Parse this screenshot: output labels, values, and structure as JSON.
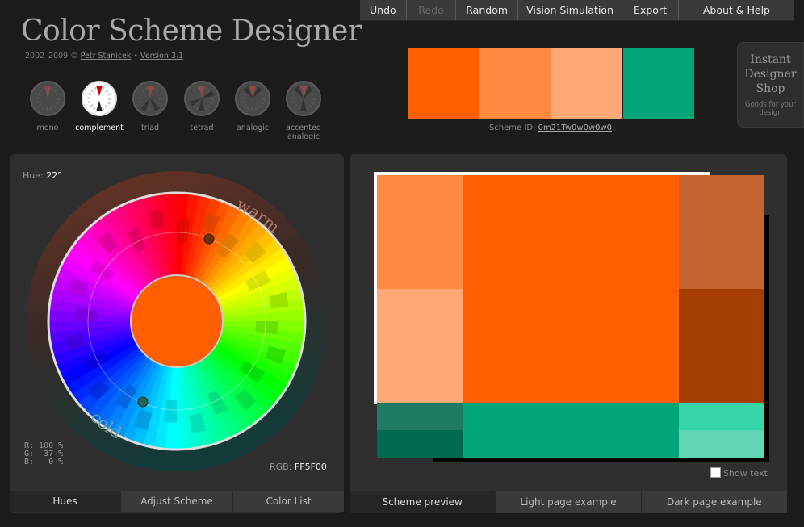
{
  "menu": [
    {
      "label": "Undo",
      "enabled": true
    },
    {
      "label": "Redo",
      "enabled": false
    },
    {
      "label": "Random",
      "enabled": true
    },
    {
      "label": "Vision Simulation",
      "enabled": true
    },
    {
      "label": "Export",
      "enabled": true
    },
    {
      "label": "About & Help",
      "enabled": true
    }
  ],
  "header": {
    "title": "Color Scheme Designer",
    "copyright_prefix": "2002–2009 © ",
    "author": "Petr Stanicek",
    "separator": " • ",
    "version": "Version 3.1"
  },
  "scheme_types": [
    {
      "label": "mono",
      "active": false
    },
    {
      "label": "complement",
      "active": true
    },
    {
      "label": "triad",
      "active": false
    },
    {
      "label": "tetrad",
      "active": false
    },
    {
      "label": "analogic",
      "active": false
    },
    {
      "label": "accented analogic",
      "active": false
    }
  ],
  "swatch_colors": [
    "#FF5F00",
    "#FF8A3F",
    "#FFAA76",
    "#00A578"
  ],
  "scheme_id": {
    "label": "Scheme ID: ",
    "value": "0m21Tw0w0w0w0"
  },
  "shop": {
    "title": "Instant Designer Shop",
    "subtitle": "Goods for your design"
  },
  "wheel": {
    "hue_label": "Hue: ",
    "hue_value": "22°",
    "warm_label": "warm",
    "cold_label": "cold",
    "rgb_r": "R: 100 %",
    "rgb_g": "G:  37 %",
    "rgb_b": "B:   0 %",
    "rgb_label": "RGB: ",
    "rgb_value": "FF5F00",
    "center_color": "#FF5F00"
  },
  "left_tabs": [
    {
      "label": "Hues",
      "active": true
    },
    {
      "label": "Adjust Scheme",
      "active": false
    },
    {
      "label": "Color List",
      "active": false
    }
  ],
  "right_tabs": [
    {
      "label": "Scheme preview",
      "active": true
    },
    {
      "label": "Light page example",
      "active": false
    },
    {
      "label": "Dark page example",
      "active": false
    }
  ],
  "preview_colors": {
    "primary": "#FF5F00",
    "primary_light1": "#FF8A3F",
    "primary_light2": "#FFAA76",
    "primary_dark1": "#C46531",
    "primary_dark2": "#A63E00",
    "comp": "#00A578",
    "comp_dark1": "#1F7C63",
    "comp_dark2": "#006B4E",
    "comp_light1": "#36D6A9",
    "comp_light2": "#60D6B5"
  },
  "show_text_label": "Show text"
}
